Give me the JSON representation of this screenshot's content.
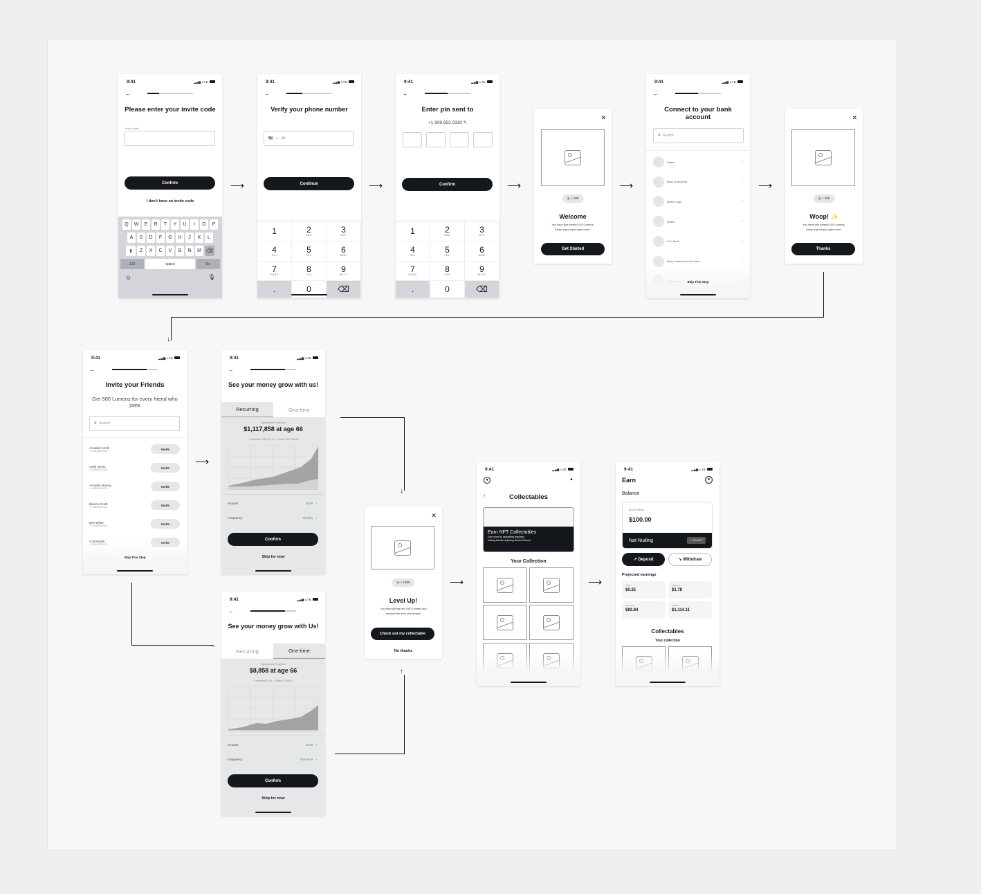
{
  "status": {
    "time": "9:41",
    "network": "LTE"
  },
  "s1": {
    "title": "Please enter your invite code",
    "field_label": "Invite code",
    "confirm": "Confirm",
    "alt_link": "I don't have an invite code",
    "kb_rows": [
      [
        "Q",
        "W",
        "E",
        "R",
        "T",
        "Y",
        "U",
        "I",
        "O",
        "P"
      ],
      [
        "A",
        "S",
        "D",
        "F",
        "G",
        "H",
        "J",
        "K",
        "L"
      ],
      [
        "Z",
        "X",
        "C",
        "V",
        "B",
        "N",
        "M"
      ]
    ],
    "kb_123": "123",
    "kb_space": "space",
    "kb_go": "Go",
    "progress": 0.25
  },
  "s2": {
    "title": "Verify your phone number",
    "country_code": "+1",
    "flag": "🇺🇸",
    "continue": "Continue",
    "progress": 0.35
  },
  "numpad": [
    {
      "d": "1",
      "l": ""
    },
    {
      "d": "2",
      "l": "ABC"
    },
    {
      "d": "3",
      "l": "DEF"
    },
    {
      "d": "4",
      "l": "GHI"
    },
    {
      "d": "5",
      "l": "JKL"
    },
    {
      "d": "6",
      "l": "MNO"
    },
    {
      "d": "7",
      "l": "PQRS"
    },
    {
      "d": "8",
      "l": "TUV"
    },
    {
      "d": "9",
      "l": "WXYZ"
    },
    {
      "d": ".",
      "l": ""
    },
    {
      "d": "0",
      "l": ""
    },
    {
      "d": "⌫",
      "l": ""
    }
  ],
  "s3": {
    "title": "Enter pin sent to",
    "phone": "+1 808 853 0330",
    "confirm": "Confirm",
    "progress": 0.5
  },
  "welcome": {
    "reward": "+ 100",
    "title": "Welcome",
    "line1": "You have just earned 100 Lumens.",
    "line2": "Keep exploring to gain more.",
    "button": "Get Started"
  },
  "bank": {
    "title": "Connect to your bank account",
    "search_placeholder": "Search",
    "banks": [
      "Chase",
      "Bank of America",
      "Wells Fargo",
      "USAA",
      "U.S. Bank",
      "Navy Federal Credit Union",
      "Wells Fargo"
    ],
    "skip": "Skip This Step",
    "progress": 0.5
  },
  "woop": {
    "reward": "+ 100",
    "title": "Woop! ✨",
    "line1": "You have just earned 100 Lumens.",
    "line2": "Keep exploring to gain more.",
    "button": "Thanks"
  },
  "invite": {
    "title": "Invite your Friends",
    "subtitle": "Get 500 Lumens for every friend who joins",
    "search_placeholder": "Search",
    "invite_label": "Invite",
    "skip": "Skip This Step",
    "progress": 0.75,
    "friends": [
      {
        "name": "Annabel Smith",
        "phone": "+1 805-853 0331"
      },
      {
        "name": "Aarik Jones",
        "phone": "+1 805-853 0331"
      },
      {
        "name": "Annabel Murray",
        "phone": "+1 805-853 0331"
      },
      {
        "name": "Bianca Smith",
        "phone": "+1 805-853 0331"
      },
      {
        "name": "Ben White",
        "phone": "+1 805-853 0331"
      },
      {
        "name": "Colt Middle",
        "phone": "+1 805-853 0331"
      },
      {
        "name": "Annabel Smith",
        "phone": "+1 805-853 0331"
      }
    ]
  },
  "grow_recurring": {
    "title": "See your money grow with us!",
    "tabs": [
      "Recurring",
      "One-time"
    ],
    "active_tab": "Recurring",
    "proj_label": "Hypothetical Projection",
    "headline": "$1,117,858 at age 66",
    "legend_investment": "Investment 180,279.94",
    "legend_return": "Return 861,578.94",
    "amount_label": "Amount",
    "amount": "$100",
    "freq_label": "Frequency",
    "freq": "Weekly",
    "confirm": "Confirm",
    "skip": "Skip for now",
    "progress": 0.75
  },
  "grow_onetime": {
    "title": "See your money grow with Us!",
    "tabs": [
      "Recurring",
      "One-time"
    ],
    "active_tab": "One-time",
    "proj_label": "Hypothetical Projection",
    "headline": "$8,858 at age 66",
    "legend_investment": "Investment 100",
    "legend_return": "Return 7,590.97",
    "amount_label": "Amount",
    "amount": "$100",
    "freq_label": "Frequency",
    "freq": "One-time",
    "confirm": "Confirm",
    "skip": "Skip for now",
    "progress": 0.75
  },
  "levelup": {
    "reward": "+ 1000",
    "title": "Level Up!",
    "line1": "You have just earned 1000 Lumens and",
    "line2": "reached the level of protostar!",
    "button": "Check out my collectable",
    "alt": "No thanks"
  },
  "collectables": {
    "title": "Collectables",
    "banner_title": "Earn NFT Collectables",
    "banner_text1": "Earn more by depositing regularly,",
    "banner_text2": "inviting friends, & joining Burst's Discord",
    "section": "Your Collection"
  },
  "earn": {
    "title": "Earn",
    "balance_label": "Balance",
    "portfolio_label": "Burst Portfolio",
    "balance": "$100.00",
    "owner": "Nat Nuding",
    "apy": "10% APY",
    "deposit": "Deposit",
    "withdraw": "Withdraw",
    "projected_label": "Projected earnings",
    "earnings": [
      {
        "period": "DAILY",
        "value": "$0.25"
      },
      {
        "period": "WEEKLY",
        "value": "$1.78"
      },
      {
        "period": "MONTHLY",
        "value": "$92.84"
      },
      {
        "period": "YEARLY",
        "value": "$1,114.11"
      }
    ],
    "collectables_title": "Collectables",
    "collection_label": "Your collection"
  }
}
